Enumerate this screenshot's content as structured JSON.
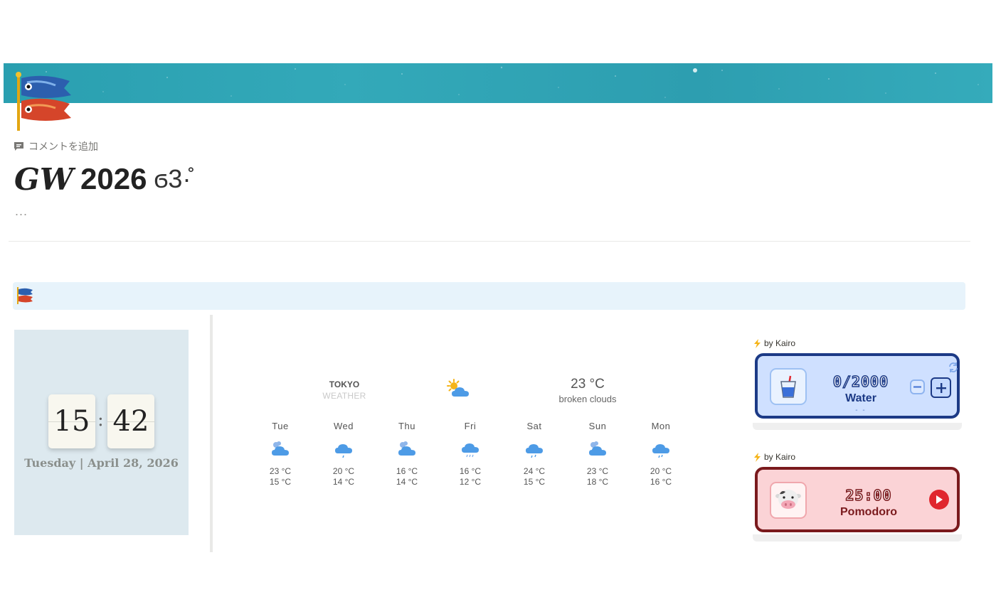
{
  "page": {
    "comment_label": "コメントを追加",
    "title_italic": "GW",
    "title_main": "2026",
    "title_kaomoji": "ϭ3·̊",
    "ellipsis": "..."
  },
  "clock": {
    "hours": "15",
    "minutes": "42",
    "separator": ":",
    "date": "Tuesday | April 28, 2026"
  },
  "weather": {
    "city": "TOKYO",
    "label": "WEATHER",
    "current_temp": "23 °C",
    "description": "broken clouds",
    "current_icon": "sun-behind-cloud-icon",
    "forecast": [
      {
        "day": "Tue",
        "high": "23 °C",
        "low": "15 °C",
        "icon": "cloud-icon"
      },
      {
        "day": "Wed",
        "high": "20 °C",
        "low": "14 °C",
        "icon": "rain-icon"
      },
      {
        "day": "Thu",
        "high": "16 °C",
        "low": "14 °C",
        "icon": "cloud-icon"
      },
      {
        "day": "Fri",
        "high": "16 °C",
        "low": "12 °C",
        "icon": "rain-icon"
      },
      {
        "day": "Sat",
        "high": "24 °C",
        "low": "15 °C",
        "icon": "rain-icon"
      },
      {
        "day": "Sun",
        "high": "23 °C",
        "low": "18 °C",
        "icon": "cloud-icon"
      },
      {
        "day": "Mon",
        "high": "20 °C",
        "low": "16 °C",
        "icon": "rain-icon"
      }
    ]
  },
  "water_widget": {
    "byline": "by Kairo",
    "value": "0/2000",
    "label": "Water",
    "sub": "- -",
    "accent": "#1c3a86",
    "background": "#cfe0ff"
  },
  "pomodoro_widget": {
    "byline": "by Kairo",
    "value": "25:00",
    "label": "Pomodoro",
    "accent": "#7a1a1d",
    "background": "#fbd3d6"
  },
  "colors": {
    "cover": "#2fa5b6",
    "callout_bg": "#e7f3fb",
    "clock_bg": "#dde9ef"
  }
}
